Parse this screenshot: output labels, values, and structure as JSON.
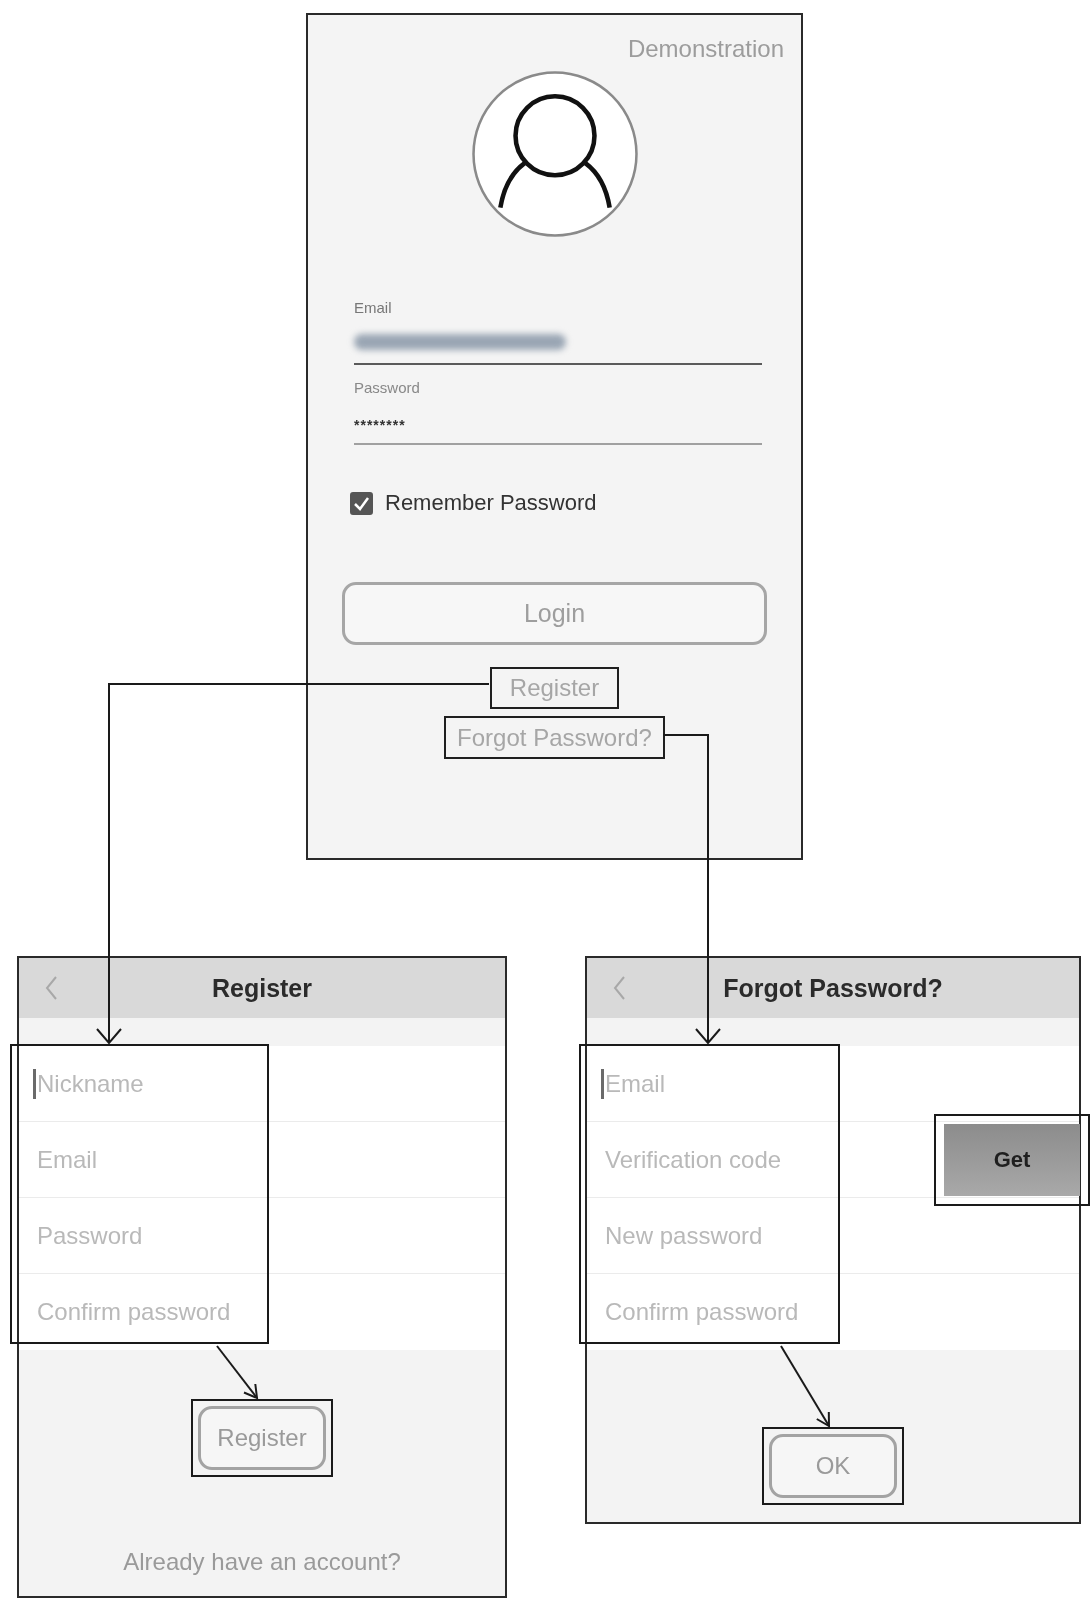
{
  "login_screen": {
    "corner_label": "Demonstration",
    "email_field": {
      "label": "Email"
    },
    "password_field": {
      "label": "Password",
      "value": "********"
    },
    "remember_password": {
      "label": "Remember Password",
      "checked": true
    },
    "login_button": {
      "label": "Login"
    },
    "register_link": {
      "label": "Register"
    },
    "forgot_password_link": {
      "label": "Forgot Password?"
    }
  },
  "register_screen": {
    "title": "Register",
    "fields": [
      {
        "placeholder": "Nickname",
        "focused": true
      },
      {
        "placeholder": "Email",
        "focused": false
      },
      {
        "placeholder": "Password",
        "focused": false
      },
      {
        "placeholder": "Confirm password",
        "focused": false
      }
    ],
    "submit_button": {
      "label": "Register"
    },
    "footer_link": {
      "label": "Already have an account?"
    }
  },
  "forgot_password_screen": {
    "title": "Forgot Password?",
    "fields": [
      {
        "placeholder": "Email",
        "focused": true
      },
      {
        "placeholder": "Verification code",
        "focused": false,
        "button": {
          "label": "Get"
        }
      },
      {
        "placeholder": "New password",
        "focused": false
      },
      {
        "placeholder": "Confirm password",
        "focused": false
      }
    ],
    "submit_button": {
      "label": "OK"
    }
  }
}
